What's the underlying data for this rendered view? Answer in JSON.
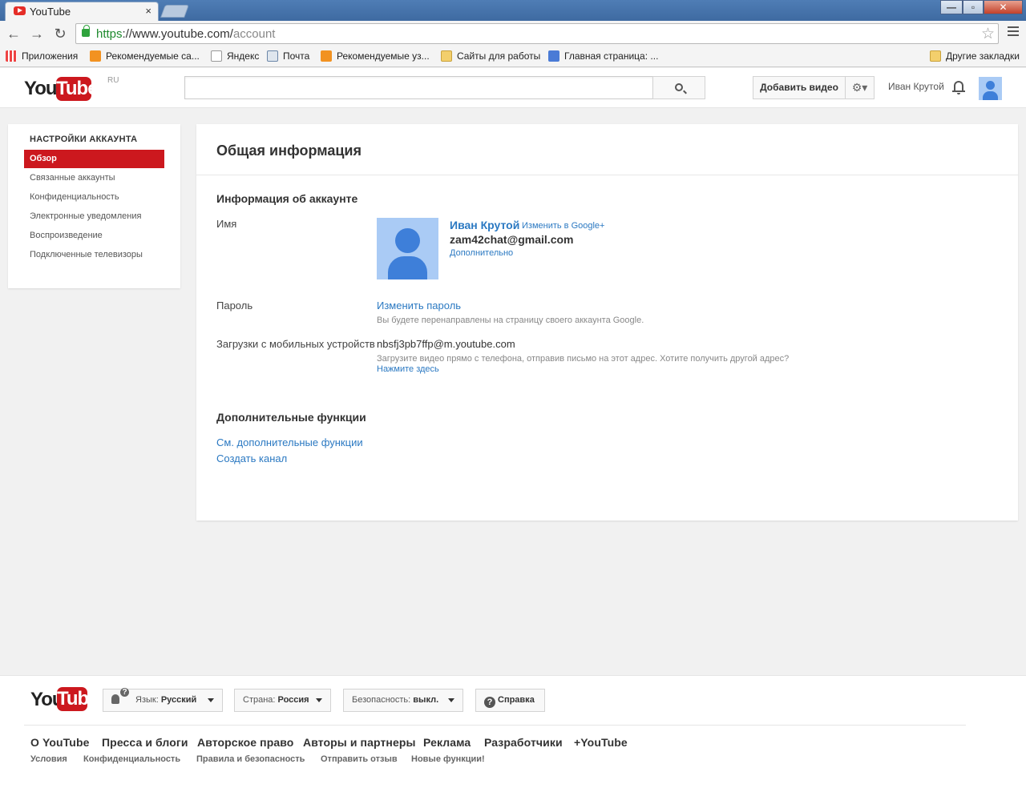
{
  "browser": {
    "tab_title": "YouTube",
    "tab_close": "×",
    "url_scheme": "https",
    "url_host": "://www.youtube.com/",
    "url_path": "account",
    "bookmarks": [
      {
        "label": "Приложения",
        "icon": "apps-icon"
      },
      {
        "label": "Рекомендуемые са...",
        "icon": "bookmark-orange-icon"
      },
      {
        "label": "Яндекс",
        "icon": "page-icon"
      },
      {
        "label": "Почта",
        "icon": "mail-icon"
      },
      {
        "label": "Рекомендуемые уз...",
        "icon": "bookmark-orange-icon"
      },
      {
        "label": "Сайты для работы",
        "icon": "folder-icon"
      },
      {
        "label": "Главная страница: ...",
        "icon": "google-icon"
      }
    ],
    "other_bookmarks": "Другие закладки"
  },
  "masthead": {
    "logo_you": "You",
    "logo_tube": "Tube",
    "logo_region": "RU",
    "search_placeholder": "",
    "upload_label": "Добавить видео",
    "gear_label": "⚙▾",
    "username": "Иван Крутой"
  },
  "sidebar": {
    "heading": "НАСТРОЙКИ АККАУНТА",
    "items": [
      {
        "label": "Обзор",
        "active": true
      },
      {
        "label": "Связанные аккаунты"
      },
      {
        "label": "Конфиденциальность"
      },
      {
        "label": "Электронные уведомления"
      },
      {
        "label": "Воспроизведение"
      },
      {
        "label": "Подключенные телевизоры"
      }
    ]
  },
  "main": {
    "title": "Общая информация",
    "account_section": "Информация об аккаунте",
    "name_label": "Имя",
    "profile_name": "Иван Крутой",
    "profile_edit": "Изменить в Google+",
    "profile_email": "zam42chat@gmail.com",
    "profile_more": "Дополнительно",
    "password_label": "Пароль",
    "password_link": "Изменить пароль",
    "password_note": "Вы будете перенаправлены на страницу своего аккаунта Google.",
    "mobile_label": "Загрузки с мобильных устройств",
    "mobile_address": "nbsfj3pb7ffp@m.youtube.com",
    "mobile_note": "Загрузите видео прямо с телефона, отправив письмо на этот адрес. Хотите получить другой адрес?",
    "mobile_link": "Нажмите здесь",
    "extra_section": "Дополнительные функции",
    "extra_links": [
      "См. дополнительные функции",
      "Создать канал"
    ]
  },
  "footer": {
    "language_prefix": "Язык:",
    "language_value": "Русский",
    "country_prefix": "Страна:",
    "country_value": "Россия",
    "safety_prefix": "Безопасность:",
    "safety_value": "выкл.",
    "help_label": "Справка",
    "links_primary": [
      "О YouTube",
      "Пресса и блоги",
      "Авторское право",
      "Авторы и партнеры",
      "Реклама",
      "Разработчики",
      "+YouTube"
    ],
    "links_secondary": [
      "Условия",
      "Конфиденциальность",
      "Правила и безопасность",
      "Отправить отзыв",
      "Новые функции!"
    ]
  },
  "colors": {
    "brand_red": "#cc181e",
    "link_blue": "#2b79c2",
    "chrome_frame": "#4f7db5",
    "avatar_bg": "#aacbf5",
    "avatar_fg": "#3e7fd9"
  }
}
